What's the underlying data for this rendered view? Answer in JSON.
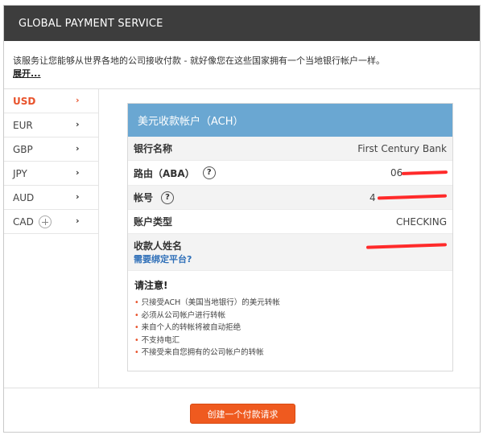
{
  "header": {
    "title": "GLOBAL PAYMENT SERVICE"
  },
  "intro": {
    "text": "该服务让您能够从世界各地的公司接收付款 - 就好像您在这些国家拥有一个当地银行帐户一样。",
    "expand_label": "展开..."
  },
  "sidebar": {
    "items": [
      {
        "label": "USD",
        "active": true
      },
      {
        "label": "EUR"
      },
      {
        "label": "GBP"
      },
      {
        "label": "JPY"
      },
      {
        "label": "AUD"
      },
      {
        "label": "CAD",
        "addable": true
      }
    ],
    "chevron": "›"
  },
  "account": {
    "header": "美元收款帐户（ACH）",
    "bank_name_label": "银行名称",
    "bank_name_value": "First Century Bank",
    "routing_label": "路由（ABA）",
    "routing_value": "06",
    "account_number_label": "帐号",
    "account_number_value": "4",
    "account_type_label": "账户类型",
    "account_type_value": "CHECKING",
    "beneficiary_label": "收款人姓名",
    "bind_link": "需要绑定平台?",
    "help_glyph": "?"
  },
  "notes": {
    "title": "请注意!",
    "bullet": "•",
    "items": [
      "只接受ACH（美国当地银行）的美元转帐",
      "必须从公司帐户进行转帐",
      "来自个人的转帐将被自动拒绝",
      "不支持电汇",
      "不接受来自您拥有的公司帐户的转帐"
    ]
  },
  "footer": {
    "create_button": "创建一个付款请求"
  },
  "colors": {
    "accent": "#e8522b",
    "card_header": "#6aa7d2",
    "header_bg": "#3d3d3d",
    "redaction": "#ff2a2a"
  }
}
